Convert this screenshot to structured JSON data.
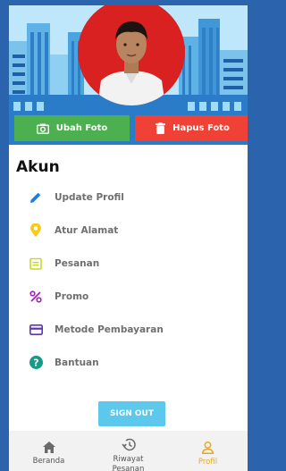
{
  "profile_header": {
    "change_photo_label": "Ubah Foto",
    "delete_photo_label": "Hapus Foto"
  },
  "account": {
    "title": "Akun",
    "items": [
      {
        "label": "Update Profil",
        "icon": "pencil-icon",
        "color": "#1e7bd8"
      },
      {
        "label": "Atur Alamat",
        "icon": "location-pin-icon",
        "color": "#f5cc17"
      },
      {
        "label": "Pesanan",
        "icon": "receipt-icon",
        "color": "#c6d92b"
      },
      {
        "label": "Promo",
        "icon": "percent-icon",
        "color": "#9c27b0"
      },
      {
        "label": "Metode Pembayaran",
        "icon": "credit-card-icon",
        "color": "#5c35b5"
      },
      {
        "label": "Bantuan",
        "icon": "help-circle-icon",
        "color": "#139c8a"
      }
    ]
  },
  "signout_label": "SIGN OUT",
  "bottom_nav": {
    "items": [
      {
        "label": "Beranda",
        "icon": "home-icon",
        "active": false
      },
      {
        "label": "Riwayat Pesanan",
        "icon": "history-icon",
        "active": false
      },
      {
        "label": "Profil",
        "icon": "person-icon",
        "active": true
      }
    ]
  },
  "colors": {
    "change_photo": "#4caf50",
    "delete_photo": "#ef4136",
    "signout": "#5bc8ec",
    "active_nav": "#e6a91f",
    "avatar_bg": "#d92121"
  }
}
